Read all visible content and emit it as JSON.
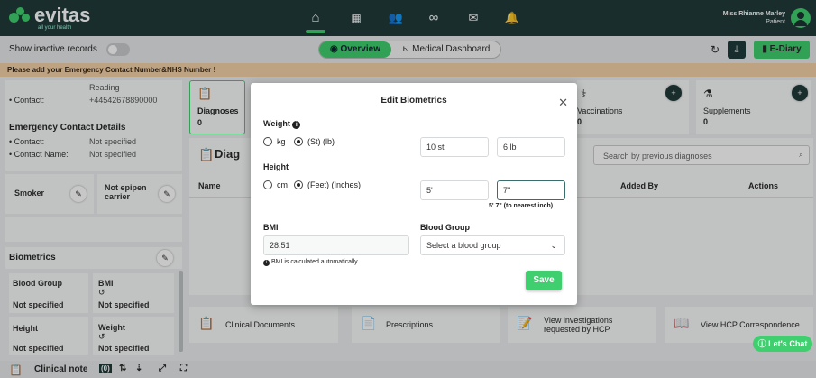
{
  "brand": {
    "name": "evitas",
    "tagline": "all your health"
  },
  "user": {
    "name": "Miss Rhianne Marley",
    "role": "Patient"
  },
  "subbar": {
    "inactive_label": "Show inactive records",
    "tab_overview": "Overview",
    "tab_dashboard": "Medical Dashboard",
    "ediary": "E-Diary"
  },
  "warning": "Please add your Emergency Contact Number&NHS Number !",
  "left": {
    "contact_label": "Contact:",
    "relationship": "Reading",
    "contact_value": "+44542678890000",
    "emergency_title": "Emergency Contact Details",
    "ec_contact_label": "Contact:",
    "ec_contact_value": "Not specified",
    "ec_name_label": "Contact Name:",
    "ec_name_value": "Not specified",
    "smoker": "Smoker",
    "epipen_line1": "Not epipen",
    "epipen_line2": "carrier",
    "biometrics_title": "Biometrics",
    "blood_group_label": "Blood Group",
    "blood_group_value": "Not specified",
    "bmi_label": "BMI",
    "bmi_value": "Not specified",
    "height_label": "Height",
    "height_value": "Not specified",
    "weight_label": "Weight",
    "weight_value": "Not specified"
  },
  "right": {
    "diagnoses_label": "Diagnoses",
    "diagnoses_count": "0",
    "vaccinations_label": "Vaccinations",
    "vaccinations_count": "0",
    "supplements_label": "Supplements",
    "supplements_count": "0",
    "diag_title": "Diag",
    "search_placeholder": "Search by previous diagnoses",
    "col_name": "Name",
    "col_added_by": "Added By",
    "col_actions": "Actions",
    "clinical_documents": "Clinical Documents",
    "prescriptions": "Prescriptions",
    "view_investigations_1": "View investigations",
    "view_investigations_2": "requested by HCP",
    "view_hcp": "View HCP Correspondence",
    "lets_chat": "Let's Chat"
  },
  "bottom": {
    "clinical_note": "Clinical note",
    "badge": "(0)"
  },
  "modal": {
    "title": "Edit Biometrics",
    "weight_label": "Weight",
    "unit_kg": "kg",
    "unit_st": "(St) (lb)",
    "weight_st": "10 st",
    "weight_lb": "6 lb",
    "height_label": "Height",
    "unit_cm": "cm",
    "unit_ft": "(Feet) (Inches)",
    "height_ft": "5'",
    "height_in": "7\"",
    "height_hint": "5' 7\" (to nearest inch)",
    "bmi_label": "BMI",
    "bmi_value": "28.51",
    "bmi_note": "BMI is calculated automatically.",
    "blood_group_label": "Blood Group",
    "blood_group_placeholder": "Select a blood group",
    "save": "Save"
  },
  "colors": {
    "accent": "#3fcf6f",
    "dark": "#203a3a",
    "warning": "#f2d1a6"
  }
}
